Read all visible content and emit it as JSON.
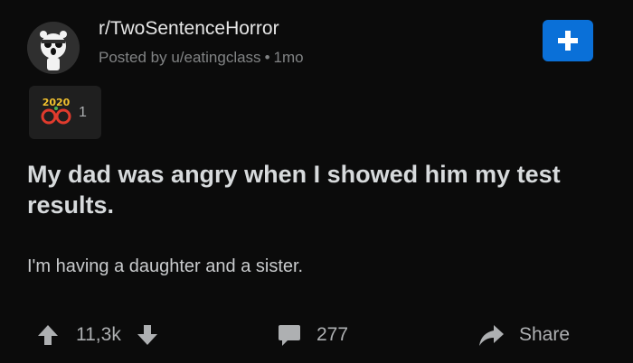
{
  "post": {
    "subreddit": "r/TwoSentenceHorror",
    "meta": {
      "posted_by": "Posted by u/eatingclass",
      "separator": "•",
      "age": "1mo"
    },
    "award": {
      "icon": "2020-glasses-award-icon",
      "count": "1"
    },
    "title": "My dad was angry when I showed him my test results.",
    "body": "I'm having a daughter and a sister."
  },
  "actions": {
    "upvotes": "11,3k",
    "comments": "277",
    "share_label": "Share"
  },
  "colors": {
    "background": "#0b0b0b",
    "accent": "#0a70d8",
    "muted": "#818384"
  }
}
